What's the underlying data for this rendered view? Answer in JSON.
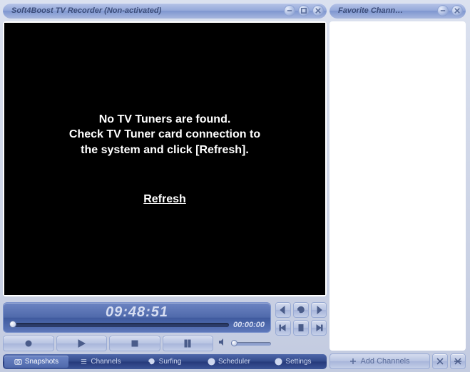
{
  "main": {
    "title": "Soft4Boost TV Recorder (Non-activated)",
    "message_line1": "No TV Tuners are found.",
    "message_line2": "Check TV Tuner card connection to",
    "message_line3": "the system and click [Refresh].",
    "refresh_label": "Refresh",
    "clock": "09:48:51",
    "elapsed": "00:00:00",
    "tabs": {
      "snapshots": "Snapshots",
      "channels": "Channels",
      "surfing": "Surfing",
      "scheduler": "Scheduler",
      "settings": "Settings"
    }
  },
  "side": {
    "title": "Favorite Chann…",
    "add_channels": "Add Channels"
  }
}
